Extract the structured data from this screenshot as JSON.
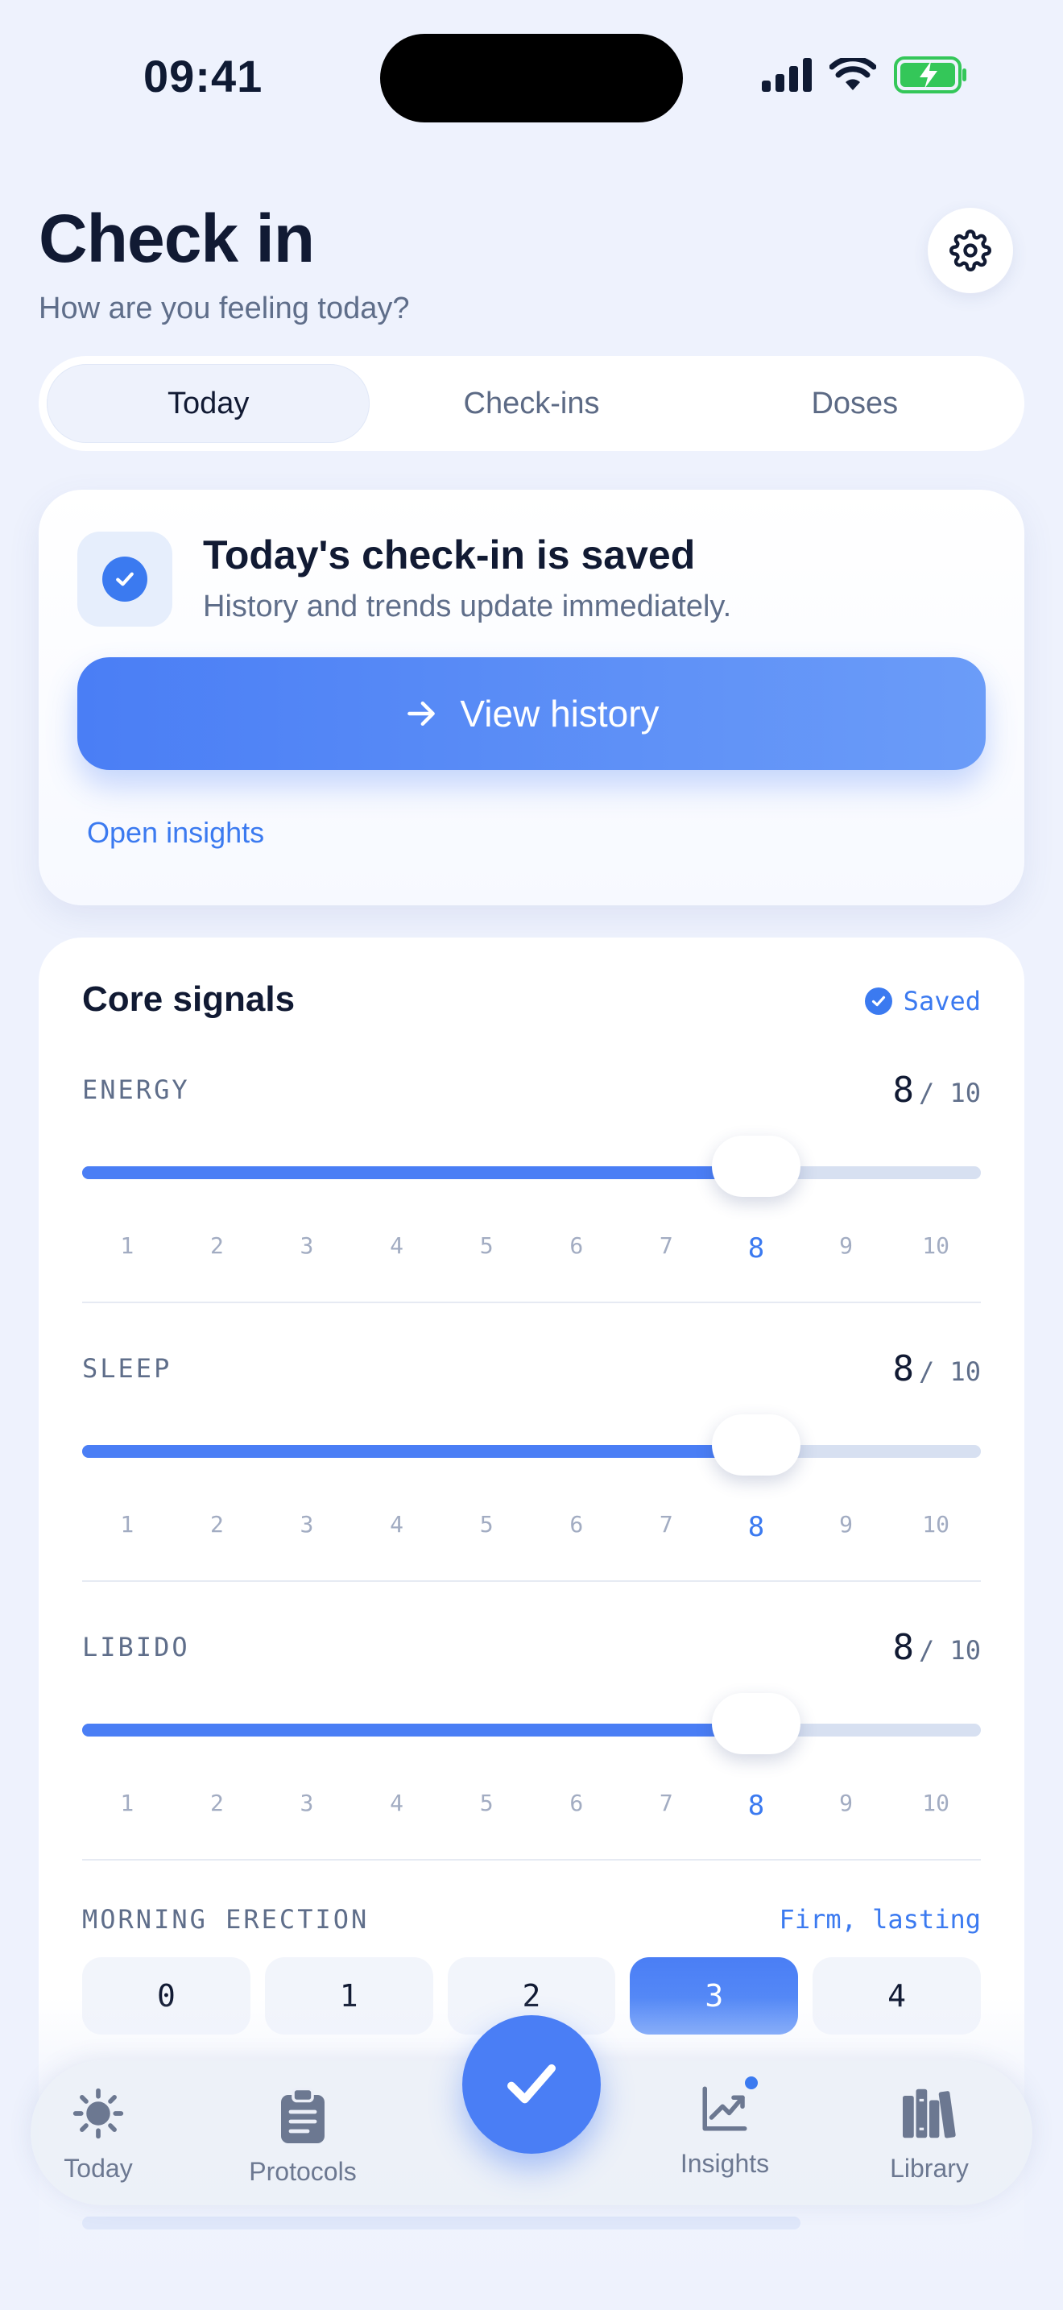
{
  "status_bar": {
    "time": "09:41"
  },
  "header": {
    "title": "Check in",
    "subtitle": "How are you feeling today?"
  },
  "tabs": [
    {
      "label": "Today",
      "active": true
    },
    {
      "label": "Check-ins",
      "active": false
    },
    {
      "label": "Doses",
      "active": false
    }
  ],
  "saved_card": {
    "title": "Today's check-in is saved",
    "description": "History and trends update immediately.",
    "button_label": "View history",
    "link_label": "Open insights"
  },
  "signals": {
    "title": "Core signals",
    "saved_label": "Saved",
    "scale_max_label": "/ 10",
    "ticks": [
      "1",
      "2",
      "3",
      "4",
      "5",
      "6",
      "7",
      "8",
      "9",
      "10"
    ],
    "metrics": [
      {
        "label": "ENERGY",
        "value": "8"
      },
      {
        "label": "SLEEP",
        "value": "8"
      },
      {
        "label": "LIBIDO",
        "value": "8"
      }
    ],
    "erection": {
      "label": "MORNING ERECTION",
      "value_label": "Firm, lasting",
      "options": [
        "0",
        "1",
        "2",
        "3",
        "4"
      ],
      "selected": "3"
    }
  },
  "tabbar": {
    "items": [
      {
        "label": "Today",
        "icon": "sun-icon"
      },
      {
        "label": "Protocols",
        "icon": "clipboard-icon"
      },
      {
        "label": "Insights",
        "icon": "chart-trend-icon"
      },
      {
        "label": "Library",
        "icon": "books-icon"
      }
    ],
    "fab_icon": "checkmark-icon"
  },
  "colors": {
    "accent": "#4a7ef5",
    "background": "#eef2fd",
    "battery": "#34c759"
  }
}
